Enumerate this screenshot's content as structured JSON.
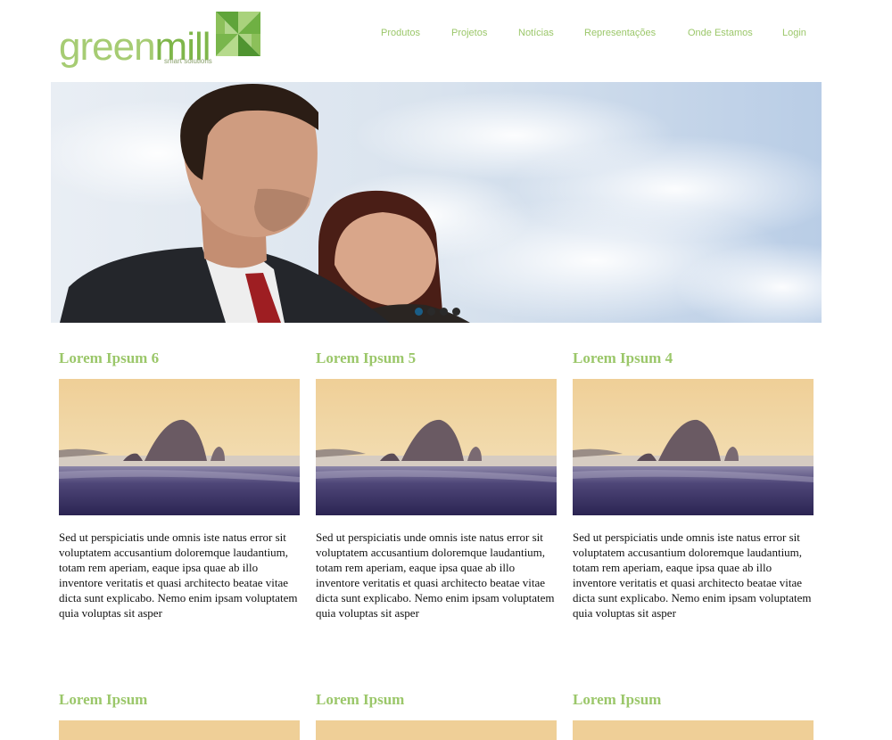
{
  "header": {
    "logo": {
      "word_green": "green",
      "word_mill": "mill",
      "tagline": "smart solutions"
    },
    "nav": [
      {
        "label": "Produtos"
      },
      {
        "label": "Projetos"
      },
      {
        "label": "Notícias"
      },
      {
        "label": "Representações"
      },
      {
        "label": "Onde Estamos"
      },
      {
        "label": "Login"
      }
    ]
  },
  "slider": {
    "slide_count": 4,
    "active_index": 0
  },
  "sections": [
    {
      "items": [
        {
          "title": "Lorem Ipsum 6",
          "text": "Sed ut perspiciatis unde omnis iste natus error sit voluptatem accusantium doloremque laudantium, totam rem aperiam, eaque ipsa quae ab illo inventore veritatis et quasi architecto beatae vitae dicta sunt explicabo. Nemo enim ipsam voluptatem quia voluptas sit asper"
        },
        {
          "title": "Lorem Ipsum 5",
          "text": "Sed ut perspiciatis unde omnis iste natus error sit voluptatem accusantium doloremque laudantium, totam rem aperiam, eaque ipsa quae ab illo inventore veritatis et quasi architecto beatae vitae dicta sunt explicabo. Nemo enim ipsam voluptatem quia voluptas sit asper"
        },
        {
          "title": "Lorem Ipsum 4",
          "text": "Sed ut perspiciatis unde omnis iste natus error sit voluptatem accusantium doloremque laudantium, totam rem aperiam, eaque ipsa quae ab illo inventore veritatis et quasi architecto beatae vitae dicta sunt explicabo. Nemo enim ipsam voluptatem quia voluptas sit asper"
        }
      ]
    },
    {
      "items": [
        {
          "title": "Lorem Ipsum"
        },
        {
          "title": "Lorem Ipsum"
        },
        {
          "title": "Lorem Ipsum"
        }
      ]
    }
  ],
  "colors": {
    "accent_green": "#9bc76a",
    "logo_green": "#a6cc73",
    "slider_active_dot": "#1a5d86",
    "slider_dot": "#2a2a2a"
  }
}
